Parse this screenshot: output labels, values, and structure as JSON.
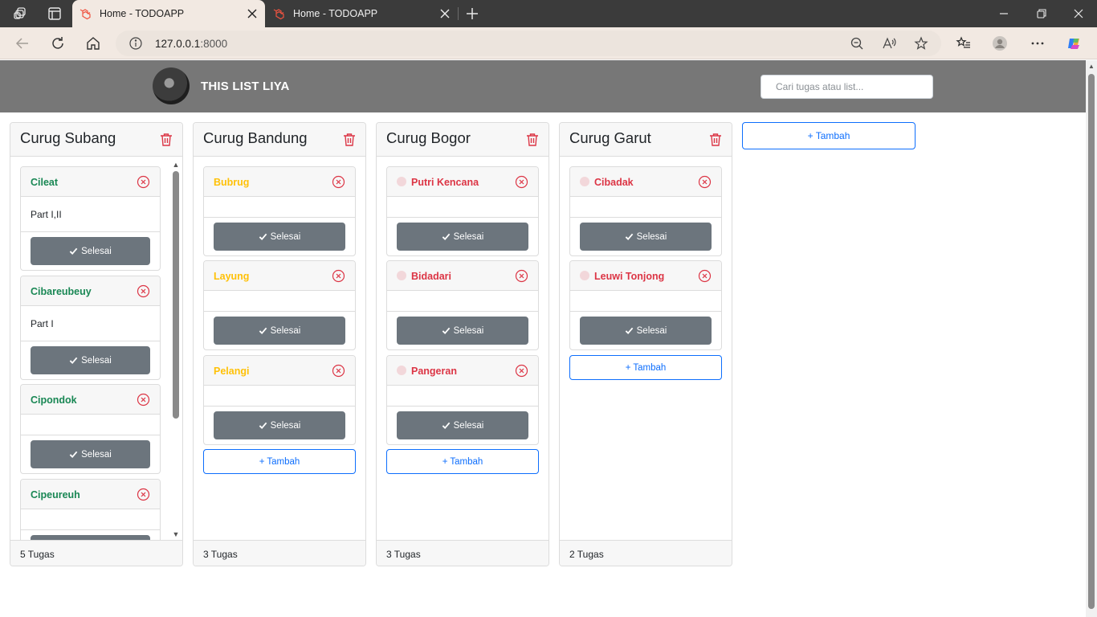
{
  "browser": {
    "tabs": [
      {
        "title": "Home - TODOAPP",
        "active": true
      },
      {
        "title": "Home - TODOAPP",
        "active": false
      }
    ],
    "url_host": "127.0.0.1",
    "url_port": ":8000"
  },
  "app": {
    "brand": "THIS LIST LIYA",
    "search_placeholder": "Cari tugas atau list..."
  },
  "lists": [
    {
      "title": "Curug Subang",
      "footer": "5 Tugas",
      "tasks": [
        {
          "title": "Cileat",
          "description": "Part I,II",
          "color": "#198754"
        },
        {
          "title": "Cibareubeuy",
          "description": "Part I",
          "color": "#198754"
        },
        {
          "title": "Cipondok",
          "description": "",
          "color": "#198754"
        },
        {
          "title": "Cipeureuh",
          "description": "",
          "color": "#198754"
        }
      ]
    },
    {
      "title": "Curug Bandung",
      "footer": "3 Tugas",
      "tasks": [
        {
          "title": "Bubrug",
          "description": "",
          "color": "#ffc107"
        },
        {
          "title": "Layung",
          "description": "",
          "color": "#ffc107"
        },
        {
          "title": "Pelangi",
          "description": "",
          "color": "#ffc107"
        }
      ]
    },
    {
      "title": "Curug Bogor",
      "footer": "3 Tugas",
      "tasks": [
        {
          "title": "Putri Kencana",
          "description": "",
          "color": "#dc3545"
        },
        {
          "title": "Bidadari",
          "description": "",
          "color": "#dc3545"
        },
        {
          "title": "Pangeran",
          "description": "",
          "color": "#dc3545"
        }
      ]
    },
    {
      "title": "Curug Garut",
      "footer": "2 Tugas",
      "tasks": [
        {
          "title": "Cibadak",
          "description": "",
          "color": "#dc3545"
        },
        {
          "title": "Leuwi Tonjong",
          "description": "",
          "color": "#dc3545"
        }
      ]
    }
  ],
  "labels": {
    "done": "Selesai",
    "add": "+ Tambah",
    "add_list": "+ Tambah"
  }
}
